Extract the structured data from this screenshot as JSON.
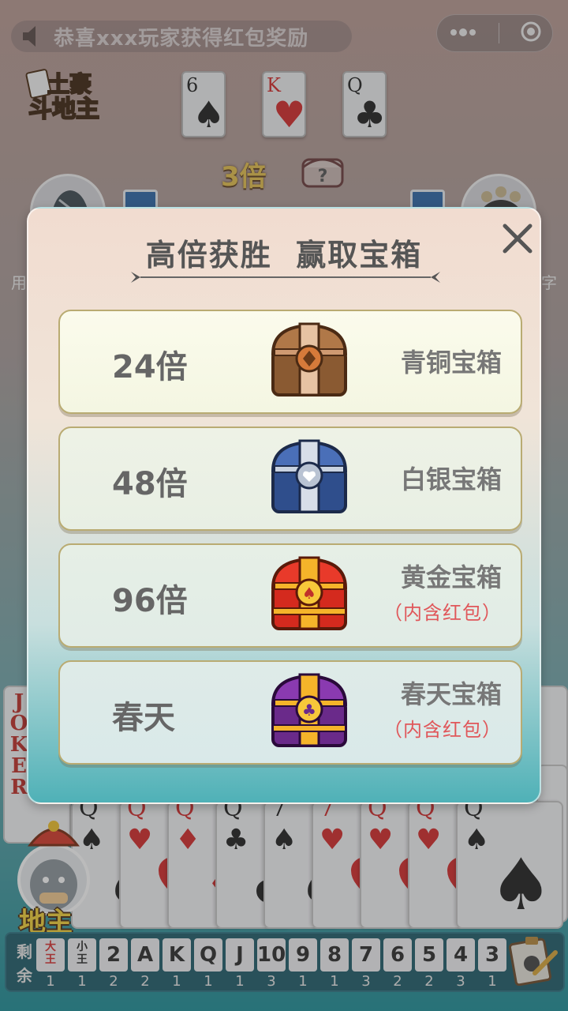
{
  "notice": {
    "text": "恭喜xxx玩家获得红包奖励"
  },
  "logo": {
    "text": "土豪斗地主"
  },
  "top_cards": [
    {
      "rank": "6",
      "suit": "♠",
      "color": "#202020"
    },
    {
      "rank": "K",
      "suit": "♥",
      "color": "#d42a2a"
    },
    {
      "rank": "Q",
      "suit": "♣",
      "color": "#202020"
    }
  ],
  "multiplier": "3倍",
  "help_chest_symbol": "?",
  "side_text": {
    "left": "用",
    "right": "字"
  },
  "modal": {
    "title": "高倍获胜  赢取宝箱",
    "close_icon": "close-icon",
    "rewards": [
      {
        "multiplier": "24倍",
        "chest": "bronze-chest-icon",
        "name": "青铜宝箱",
        "note": ""
      },
      {
        "multiplier": "48倍",
        "chest": "silver-chest-icon",
        "name": "白银宝箱",
        "note": ""
      },
      {
        "multiplier": "96倍",
        "chest": "gold-chest-icon",
        "name": "黄金宝箱",
        "note": "（内含红包）"
      },
      {
        "multiplier": "春天",
        "chest": "spring-chest-icon",
        "name": "春天宝箱",
        "note": "（内含红包）"
      }
    ]
  },
  "joker_text": "JOKER",
  "hand_cards": [
    {
      "rank": "Q",
      "suit": "♠",
      "color": "#202020"
    },
    {
      "rank": "Q",
      "suit": "♥",
      "color": "#d42a2a"
    },
    {
      "rank": "Q",
      "suit": "♦",
      "color": "#d42a2a"
    },
    {
      "rank": "Q",
      "suit": "♣",
      "color": "#202020"
    },
    {
      "rank": "7",
      "suit": "♠",
      "color": "#202020"
    },
    {
      "rank": "7",
      "suit": "♥",
      "color": "#d42a2a"
    },
    {
      "rank": "Q",
      "suit": "♥",
      "color": "#d42a2a"
    },
    {
      "rank": "Q",
      "suit": "♥",
      "color": "#d42a2a"
    },
    {
      "rank": "Q",
      "suit": "♠",
      "color": "#202020"
    }
  ],
  "landlord_label": "地主",
  "counter": {
    "label": "剩余",
    "cells": [
      {
        "card": "大王",
        "count": "1"
      },
      {
        "card": "小王",
        "count": "1"
      },
      {
        "card": "2",
        "count": "2"
      },
      {
        "card": "A",
        "count": "2"
      },
      {
        "card": "K",
        "count": "1"
      },
      {
        "card": "Q",
        "count": "1"
      },
      {
        "card": "J",
        "count": "1"
      },
      {
        "card": "10",
        "count": "3"
      },
      {
        "card": "9",
        "count": "1"
      },
      {
        "card": "8",
        "count": "1"
      },
      {
        "card": "7",
        "count": "3"
      },
      {
        "card": "6",
        "count": "2"
      },
      {
        "card": "5",
        "count": "2"
      },
      {
        "card": "4",
        "count": "3"
      },
      {
        "card": "3",
        "count": "1"
      }
    ]
  }
}
